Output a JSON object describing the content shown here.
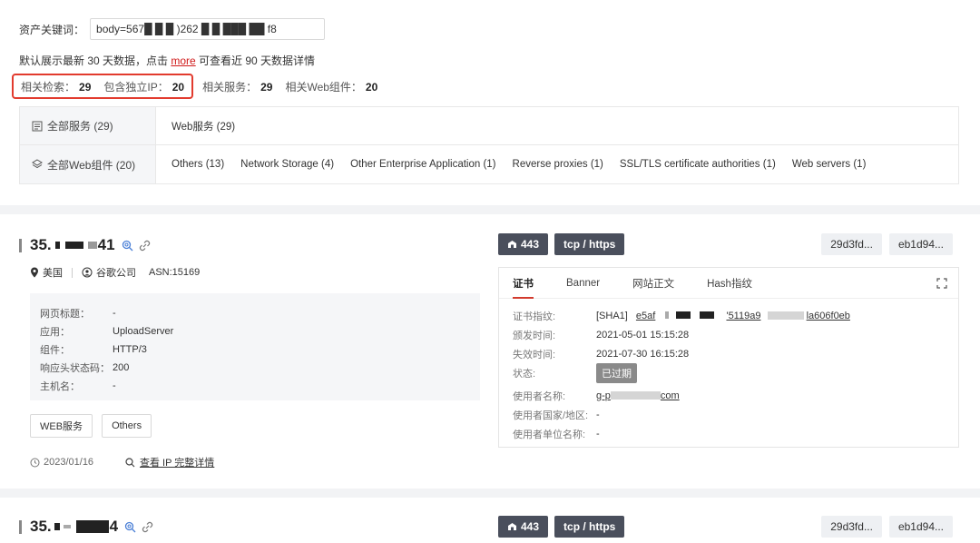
{
  "search": {
    "label": "资产关键词：",
    "value": "body=567█ █ █ )262 █ █ ███ ██ f8"
  },
  "notice": {
    "before": "默认展示最新 30 天数据，点击 ",
    "link": "more",
    "after": " 可查看近 90 天数据详情"
  },
  "stats": [
    {
      "label": "相关检索：",
      "value": "29"
    },
    {
      "label": "包含独立IP：",
      "value": "20"
    },
    {
      "label": "相关服务：",
      "value": "29"
    },
    {
      "label": "相关Web组件：",
      "value": "20"
    }
  ],
  "filters": {
    "services": {
      "head": "全部服务 (29)",
      "items": [
        "Web服务 (29)"
      ]
    },
    "components": {
      "head": "全部Web组件 (20)",
      "items": [
        "Others (13)",
        "Network Storage (4)",
        "Other Enterprise Application (1)",
        "Reverse proxies (1)",
        "SSL/TLS certificate authorities (1)",
        "Web servers (1)"
      ]
    }
  },
  "result1": {
    "ip_prefix": "35.",
    "ip_suffix": "41",
    "country": "美国",
    "org": "谷歌公司",
    "asn": "ASN:15169",
    "info": [
      {
        "k": "网页标题：",
        "v": "-"
      },
      {
        "k": "应用：",
        "v": "UploadServer"
      },
      {
        "k": "组件：",
        "v": "HTTP/3"
      },
      {
        "k": "响应头状态码：",
        "v": "200"
      },
      {
        "k": "主机名：",
        "v": "-"
      }
    ],
    "tags": [
      "WEB服务",
      "Others"
    ],
    "date": "2023/01/16",
    "detail_link": "查看 IP 完整详情",
    "port": "443",
    "protocol": "tcp / https",
    "hashes": [
      "29d3fd...",
      "eb1d94..."
    ],
    "cert_tabs": [
      "证书",
      "Banner",
      "网站正文",
      "Hash指纹"
    ],
    "cert": {
      "fingerprint_label": "证书指纹:",
      "fingerprint_prefix": "[SHA1]",
      "fingerprint_parts": [
        "e5af",
        "'5119a9",
        "la606f0eb"
      ],
      "issued_label": "颁发时间:",
      "issued": "2021-05-01 15:15:28",
      "expire_label": "失效时间:",
      "expire": "2021-07-30 16:15:28",
      "status_label": "状态:",
      "status": "已过期",
      "subject_label": "使用者名称:",
      "subject_prefix": "g-p",
      "subject_suffix": "com",
      "country_label": "使用者国家/地区:",
      "country": "-",
      "unit_label": "使用者单位名称:",
      "unit": "-"
    }
  },
  "result2": {
    "ip_prefix": "35.",
    "ip_suffix": "4",
    "port": "443",
    "protocol": "tcp / https",
    "hashes": [
      "29d3fd...",
      "eb1d94..."
    ]
  }
}
